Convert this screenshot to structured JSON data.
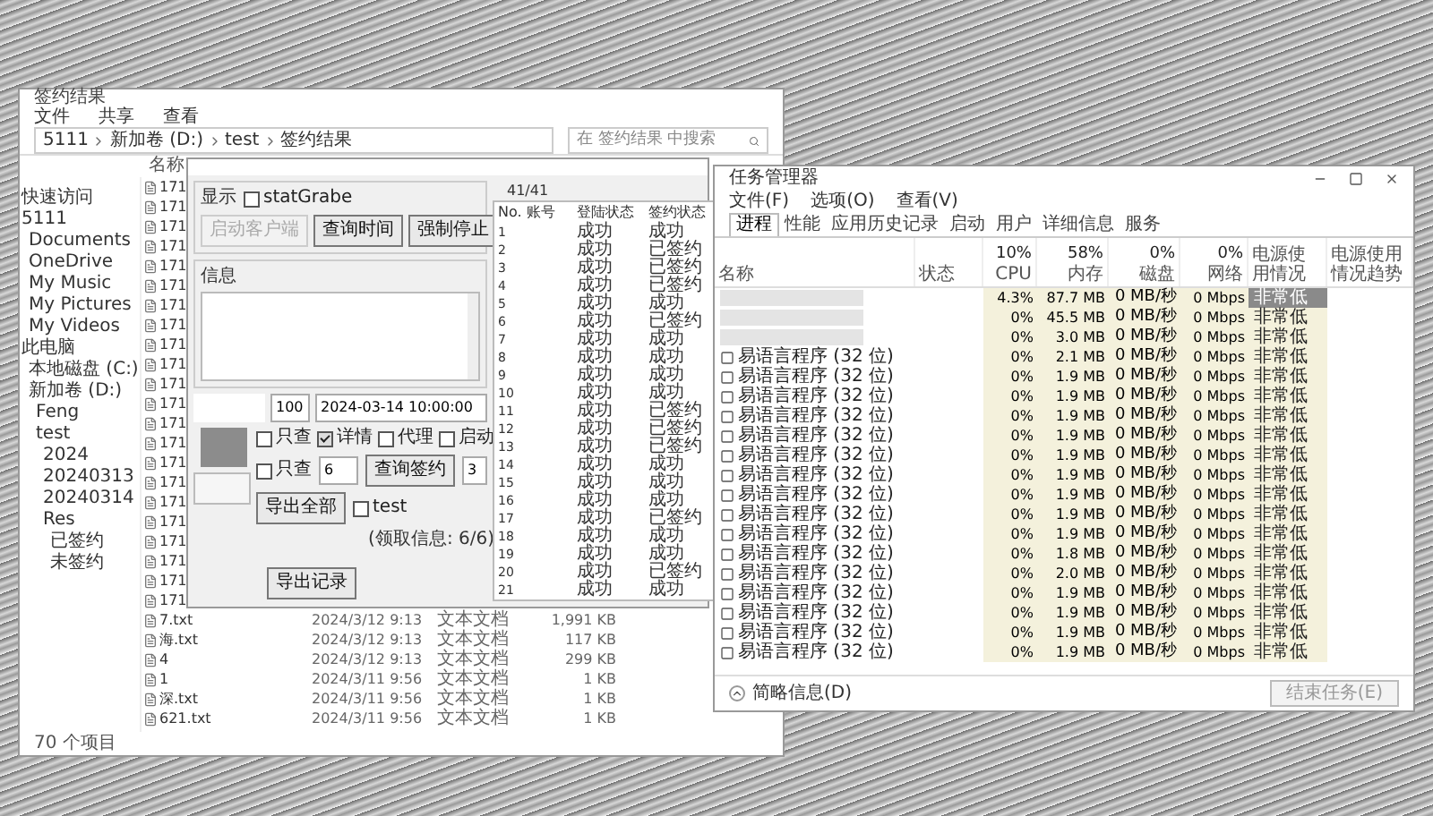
{
  "explorer": {
    "title": "签约结果",
    "menu": [
      "文件",
      "共享",
      "查看"
    ],
    "breadcrumb": [
      "5111",
      "新加卷 (D:)",
      "test",
      "签约结果"
    ],
    "search": {
      "placeholder": "在 签约结果 中搜索"
    },
    "sidebar": [
      {
        "label": "快速访问"
      },
      {
        "label": "5111",
        "children": [
          {
            "label": "Documents"
          },
          {
            "label": "OneDrive"
          },
          {
            "label": "My Music"
          },
          {
            "label": "My Pictures"
          },
          {
            "label": "My Videos"
          }
        ]
      },
      {
        "label": "此电脑",
        "children": [
          {
            "label": "本地磁盘 (C:)"
          },
          {
            "label": "新加卷 (D:)",
            "children": [
              {
                "label": "Feng"
              },
              {
                "label": "test",
                "children": [
                  {
                    "label": "2024"
                  },
                  {
                    "label": "20240313"
                  },
                  {
                    "label": "20240314"
                  },
                  {
                    "label": "Res",
                    "children": [
                      {
                        "label": "已签约"
                      },
                      {
                        "label": "未签约"
                      }
                    ]
                  }
                ]
              }
            ]
          }
        ]
      }
    ],
    "name_header": "名称",
    "files": [
      {
        "name": "171"
      },
      {
        "name": "171"
      },
      {
        "name": "171"
      },
      {
        "name": "171"
      },
      {
        "name": "171"
      },
      {
        "name": "171"
      },
      {
        "name": "171"
      },
      {
        "name": "171"
      },
      {
        "name": "171"
      },
      {
        "name": "171"
      },
      {
        "name": "171"
      },
      {
        "name": "171"
      },
      {
        "name": "171"
      },
      {
        "name": "171"
      },
      {
        "name": "171"
      },
      {
        "name": "171"
      },
      {
        "name": "171"
      },
      {
        "name": "171"
      },
      {
        "name": "171"
      },
      {
        "name": "171"
      },
      {
        "name": "171"
      },
      {
        "name": "171"
      },
      {
        "name": "7.txt",
        "date": "2024/3/12 9:13",
        "type": "文本文档",
        "size": "1,991 KB"
      },
      {
        "name": "海.txt",
        "date": "2024/3/12 9:13",
        "type": "文本文档",
        "size": "117 KB"
      },
      {
        "name": "4",
        "date": "2024/3/12 9:13",
        "type": "文本文档",
        "size": "299 KB"
      },
      {
        "name": "1",
        "date": "2024/3/11 9:56",
        "type": "文本文档",
        "size": "1 KB"
      },
      {
        "name": "深.txt",
        "date": "2024/3/11 9:56",
        "type": "文本文档",
        "size": "1 KB"
      },
      {
        "name": "621.txt",
        "date": "2024/3/11 9:56",
        "type": "文本文档",
        "size": "1 KB"
      }
    ],
    "status_bar": "70 个项目"
  },
  "app": {
    "display_group": "显示",
    "display_check": {
      "label": "statGrabe",
      "checked": false
    },
    "buttons": [
      {
        "label": "启动客户端",
        "disabled": true
      },
      {
        "label": "查询时间",
        "disabled": false
      },
      {
        "label": "强制停止",
        "disabled": false
      }
    ],
    "info_group": "信息",
    "count_value": "100",
    "datetime_value": "2024-03-14 10:00:00",
    "options": [
      {
        "label": "只查",
        "checked": false
      },
      {
        "label": "详情",
        "checked": true
      },
      {
        "label": "代理",
        "checked": false
      },
      {
        "label": "启动",
        "checked": false
      }
    ],
    "option2": {
      "label": "只查",
      "checked": false
    },
    "field_a": "6",
    "query_button": "查询签约",
    "field_b": "3",
    "export_all": "导出全部",
    "test_check": {
      "label": "test",
      "checked": false
    },
    "info_text": "(领取信息: 6/6)",
    "export_log": "导出记录",
    "counter": "41/41",
    "columns": [
      "No.",
      "账号",
      "登陆状态",
      "签约状态"
    ],
    "rows": [
      {
        "no": "1",
        "login": "成功",
        "sign": "成功"
      },
      {
        "no": "2",
        "login": "成功",
        "sign": "已签约"
      },
      {
        "no": "3",
        "login": "成功",
        "sign": "已签约"
      },
      {
        "no": "4",
        "login": "成功",
        "sign": "已签约"
      },
      {
        "no": "5",
        "login": "成功",
        "sign": "成功"
      },
      {
        "no": "6",
        "login": "成功",
        "sign": "已签约"
      },
      {
        "no": "7",
        "login": "成功",
        "sign": "成功"
      },
      {
        "no": "8",
        "login": "成功",
        "sign": "成功"
      },
      {
        "no": "9",
        "login": "成功",
        "sign": "成功"
      },
      {
        "no": "10",
        "login": "成功",
        "sign": "成功"
      },
      {
        "no": "11",
        "login": "成功",
        "sign": "已签约"
      },
      {
        "no": "12",
        "login": "成功",
        "sign": "已签约"
      },
      {
        "no": "13",
        "login": "成功",
        "sign": "已签约"
      },
      {
        "no": "14",
        "login": "成功",
        "sign": "成功"
      },
      {
        "no": "15",
        "login": "成功",
        "sign": "成功"
      },
      {
        "no": "16",
        "login": "成功",
        "sign": "成功"
      },
      {
        "no": "17",
        "login": "成功",
        "sign": "已签约"
      },
      {
        "no": "18",
        "login": "成功",
        "sign": "成功"
      },
      {
        "no": "19",
        "login": "成功",
        "sign": "成功"
      },
      {
        "no": "20",
        "login": "成功",
        "sign": "已签约"
      },
      {
        "no": "21",
        "login": "成功",
        "sign": "成功"
      }
    ]
  },
  "taskmgr": {
    "title": "任务管理器",
    "menu": [
      "文件(F)",
      "选项(O)",
      "查看(V)"
    ],
    "tabs": [
      {
        "label": "进程",
        "selected": true
      },
      {
        "label": "性能",
        "selected": false
      },
      {
        "label": "应用历史记录",
        "selected": false
      },
      {
        "label": "启动",
        "selected": false
      },
      {
        "label": "用户",
        "selected": false
      },
      {
        "label": "详细信息",
        "selected": false
      },
      {
        "label": "服务",
        "selected": false
      }
    ],
    "columns": [
      {
        "label": "名称"
      },
      {
        "label": "状态"
      },
      {
        "usage": "10%",
        "label": "CPU"
      },
      {
        "usage": "58%",
        "label": "内存"
      },
      {
        "usage": "0%",
        "label": "磁盘"
      },
      {
        "usage": "0%",
        "label": "网络"
      },
      {
        "label": "电源使用情况"
      },
      {
        "label": "电源使用情况趋势"
      }
    ],
    "rows": [
      {
        "cpu": "4.3%",
        "mem": "87.7 MB",
        "disk": "0 MB/秒",
        "net": "0 Mbps",
        "power": "非常低",
        "highlighted": true
      },
      {
        "cpu": "0%",
        "mem": "45.5 MB",
        "disk": "0 MB/秒",
        "net": "0 Mbps",
        "power": "非常低",
        "highlighted": false
      },
      {
        "cpu": "0%",
        "mem": "3.0 MB",
        "disk": "0 MB/秒",
        "net": "0 Mbps",
        "power": "非常低",
        "highlighted": false
      },
      {
        "name": "易语言程序 (32 位)",
        "cpu": "0%",
        "mem": "2.1 MB",
        "disk": "0 MB/秒",
        "net": "0 Mbps",
        "power": "非常低",
        "highlighted": false
      },
      {
        "name": "易语言程序 (32 位)",
        "cpu": "0%",
        "mem": "1.9 MB",
        "disk": "0 MB/秒",
        "net": "0 Mbps",
        "power": "非常低",
        "highlighted": false
      },
      {
        "name": "易语言程序 (32 位)",
        "cpu": "0%",
        "mem": "1.9 MB",
        "disk": "0 MB/秒",
        "net": "0 Mbps",
        "power": "非常低",
        "highlighted": false
      },
      {
        "name": "易语言程序 (32 位)",
        "cpu": "0%",
        "mem": "1.9 MB",
        "disk": "0 MB/秒",
        "net": "0 Mbps",
        "power": "非常低",
        "highlighted": false
      },
      {
        "name": "易语言程序 (32 位)",
        "cpu": "0%",
        "mem": "1.9 MB",
        "disk": "0 MB/秒",
        "net": "0 Mbps",
        "power": "非常低",
        "highlighted": false
      },
      {
        "name": "易语言程序 (32 位)",
        "cpu": "0%",
        "mem": "1.9 MB",
        "disk": "0 MB/秒",
        "net": "0 Mbps",
        "power": "非常低",
        "highlighted": false
      },
      {
        "name": "易语言程序 (32 位)",
        "cpu": "0%",
        "mem": "1.9 MB",
        "disk": "0 MB/秒",
        "net": "0 Mbps",
        "power": "非常低",
        "highlighted": false
      },
      {
        "name": "易语言程序 (32 位)",
        "cpu": "0%",
        "mem": "1.9 MB",
        "disk": "0 MB/秒",
        "net": "0 Mbps",
        "power": "非常低",
        "highlighted": false
      },
      {
        "name": "易语言程序 (32 位)",
        "cpu": "0%",
        "mem": "1.9 MB",
        "disk": "0 MB/秒",
        "net": "0 Mbps",
        "power": "非常低",
        "highlighted": false
      },
      {
        "name": "易语言程序 (32 位)",
        "cpu": "0%",
        "mem": "1.9 MB",
        "disk": "0 MB/秒",
        "net": "0 Mbps",
        "power": "非常低",
        "highlighted": false
      },
      {
        "name": "易语言程序 (32 位)",
        "cpu": "0%",
        "mem": "1.8 MB",
        "disk": "0 MB/秒",
        "net": "0 Mbps",
        "power": "非常低",
        "highlighted": false
      },
      {
        "name": "易语言程序 (32 位)",
        "cpu": "0%",
        "mem": "2.0 MB",
        "disk": "0 MB/秒",
        "net": "0 Mbps",
        "power": "非常低",
        "highlighted": false
      },
      {
        "name": "易语言程序 (32 位)",
        "cpu": "0%",
        "mem": "1.9 MB",
        "disk": "0 MB/秒",
        "net": "0 Mbps",
        "power": "非常低",
        "highlighted": false
      },
      {
        "name": "易语言程序 (32 位)",
        "cpu": "0%",
        "mem": "1.9 MB",
        "disk": "0 MB/秒",
        "net": "0 Mbps",
        "power": "非常低",
        "highlighted": false
      },
      {
        "name": "易语言程序 (32 位)",
        "cpu": "0%",
        "mem": "1.9 MB",
        "disk": "0 MB/秒",
        "net": "0 Mbps",
        "power": "非常低",
        "highlighted": false
      },
      {
        "name": "易语言程序 (32 位)",
        "cpu": "0%",
        "mem": "1.9 MB",
        "disk": "0 MB/秒",
        "net": "0 Mbps",
        "power": "非常低",
        "highlighted": false
      }
    ],
    "less_details": "简略信息(D)",
    "end_task": "结束任务(E)"
  }
}
